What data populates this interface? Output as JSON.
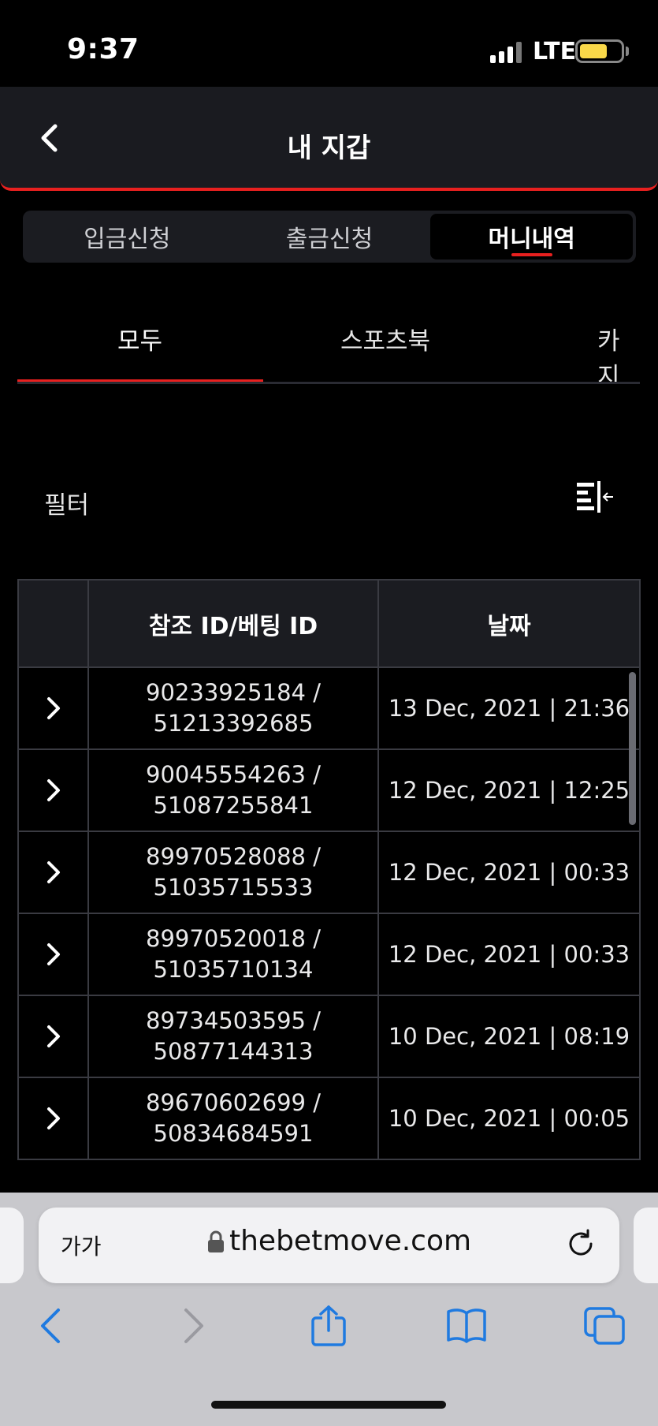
{
  "status_bar": {
    "time": "9:37",
    "network": "LTE",
    "battery_color": "#f9d849"
  },
  "header": {
    "title": "내 지갑",
    "accent": "#e8201f"
  },
  "top_tabs": [
    {
      "label": "입금신청",
      "active": false
    },
    {
      "label": "출금신청",
      "active": false
    },
    {
      "label": "머니내역",
      "active": true
    }
  ],
  "category_tabs": [
    {
      "label": "모두",
      "active": true
    },
    {
      "label": "스포츠북",
      "active": false
    },
    {
      "label": "카지",
      "active": false
    }
  ],
  "filter": {
    "label": "필터",
    "icon": "filter-icon"
  },
  "table": {
    "headers": [
      "",
      "참조 ID/베팅 ID",
      "날짜"
    ],
    "rows": [
      {
        "ref": "90233925184 /",
        "bet": "51213392685",
        "date": "13 Dec, 2021 | 21:36"
      },
      {
        "ref": "90045554263 /",
        "bet": "51087255841",
        "date": "12 Dec, 2021 | 12:25"
      },
      {
        "ref": "89970528088 /",
        "bet": "51035715533",
        "date": "12 Dec, 2021 | 00:33"
      },
      {
        "ref": "89970520018 /",
        "bet": "51035710134",
        "date": "12 Dec, 2021 | 00:33"
      },
      {
        "ref": "89734503595 /",
        "bet": "50877144313",
        "date": "10 Dec, 2021 | 08:19"
      },
      {
        "ref": "89670602699 /",
        "bet": "50834684591",
        "date": "10 Dec, 2021 | 00:05"
      }
    ]
  },
  "browser": {
    "aa_label": "가가",
    "url": "thebetmove.com",
    "accent": "#1f7ae0"
  }
}
